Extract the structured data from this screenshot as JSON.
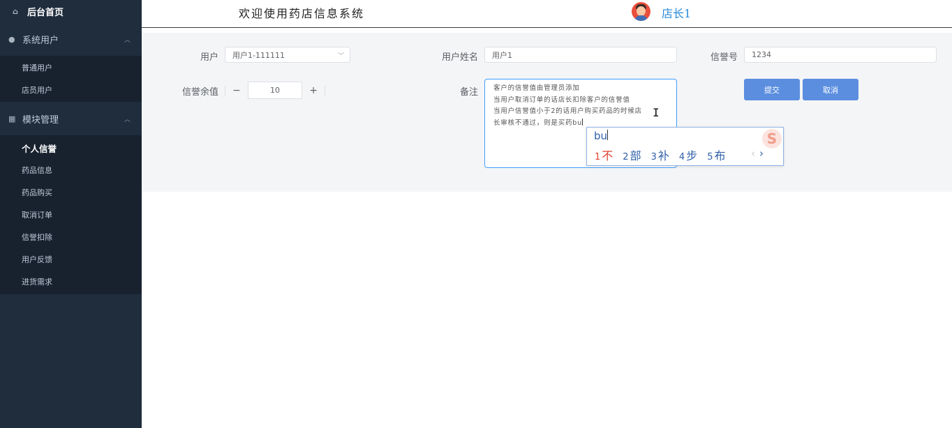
{
  "sidebar": {
    "home": {
      "label": "后台首页",
      "icon": "home-icon"
    },
    "groups": [
      {
        "label": "系统用户",
        "icon": "user-icon",
        "items": [
          "普通用户",
          "店员用户"
        ]
      },
      {
        "label": "模块管理",
        "icon": "grid-icon",
        "items": [
          "个人信誉",
          "药品信息",
          "药品购买",
          "取消订单",
          "信誉扣除",
          "用户反馈",
          "进货需求"
        ],
        "active_index": 0
      }
    ]
  },
  "header": {
    "welcome": "欢迎使用药店信息系统",
    "user_name": "店长1"
  },
  "form": {
    "user_label": "用户",
    "user_value": "用户1-111111",
    "username_label": "用户姓名",
    "username_value": "用户1",
    "credit_no_label": "信誉号",
    "credit_no_value": "1234",
    "balance_label": "信誉余值",
    "balance_minus": "−",
    "balance_value": "10",
    "balance_plus": "+",
    "remark_label": "备注",
    "remark_lines": [
      "客户的信誉值由管理员添加",
      "当用户取消订单的话店长扣除客户的信誉值",
      "当用户信誉值小于2的话用户购买药品的时候店",
      "长审核不通过，则是买药bu"
    ],
    "submit_label": "提交",
    "cancel_label": "取消"
  },
  "ime": {
    "input": "bu",
    "candidates": [
      {
        "num": "1",
        "text": "不"
      },
      {
        "num": "2",
        "text": "部"
      },
      {
        "num": "3",
        "text": "补"
      },
      {
        "num": "4",
        "text": "步"
      },
      {
        "num": "5",
        "text": "布"
      }
    ],
    "prev": "‹",
    "next": "›",
    "logo": "S"
  },
  "colors": {
    "sidebar_bg": "#1f2d3d",
    "primary": "#5b8edf",
    "focus_border": "#409eff",
    "ime_selected": "#e0412e",
    "username": "#2a8ad8"
  }
}
